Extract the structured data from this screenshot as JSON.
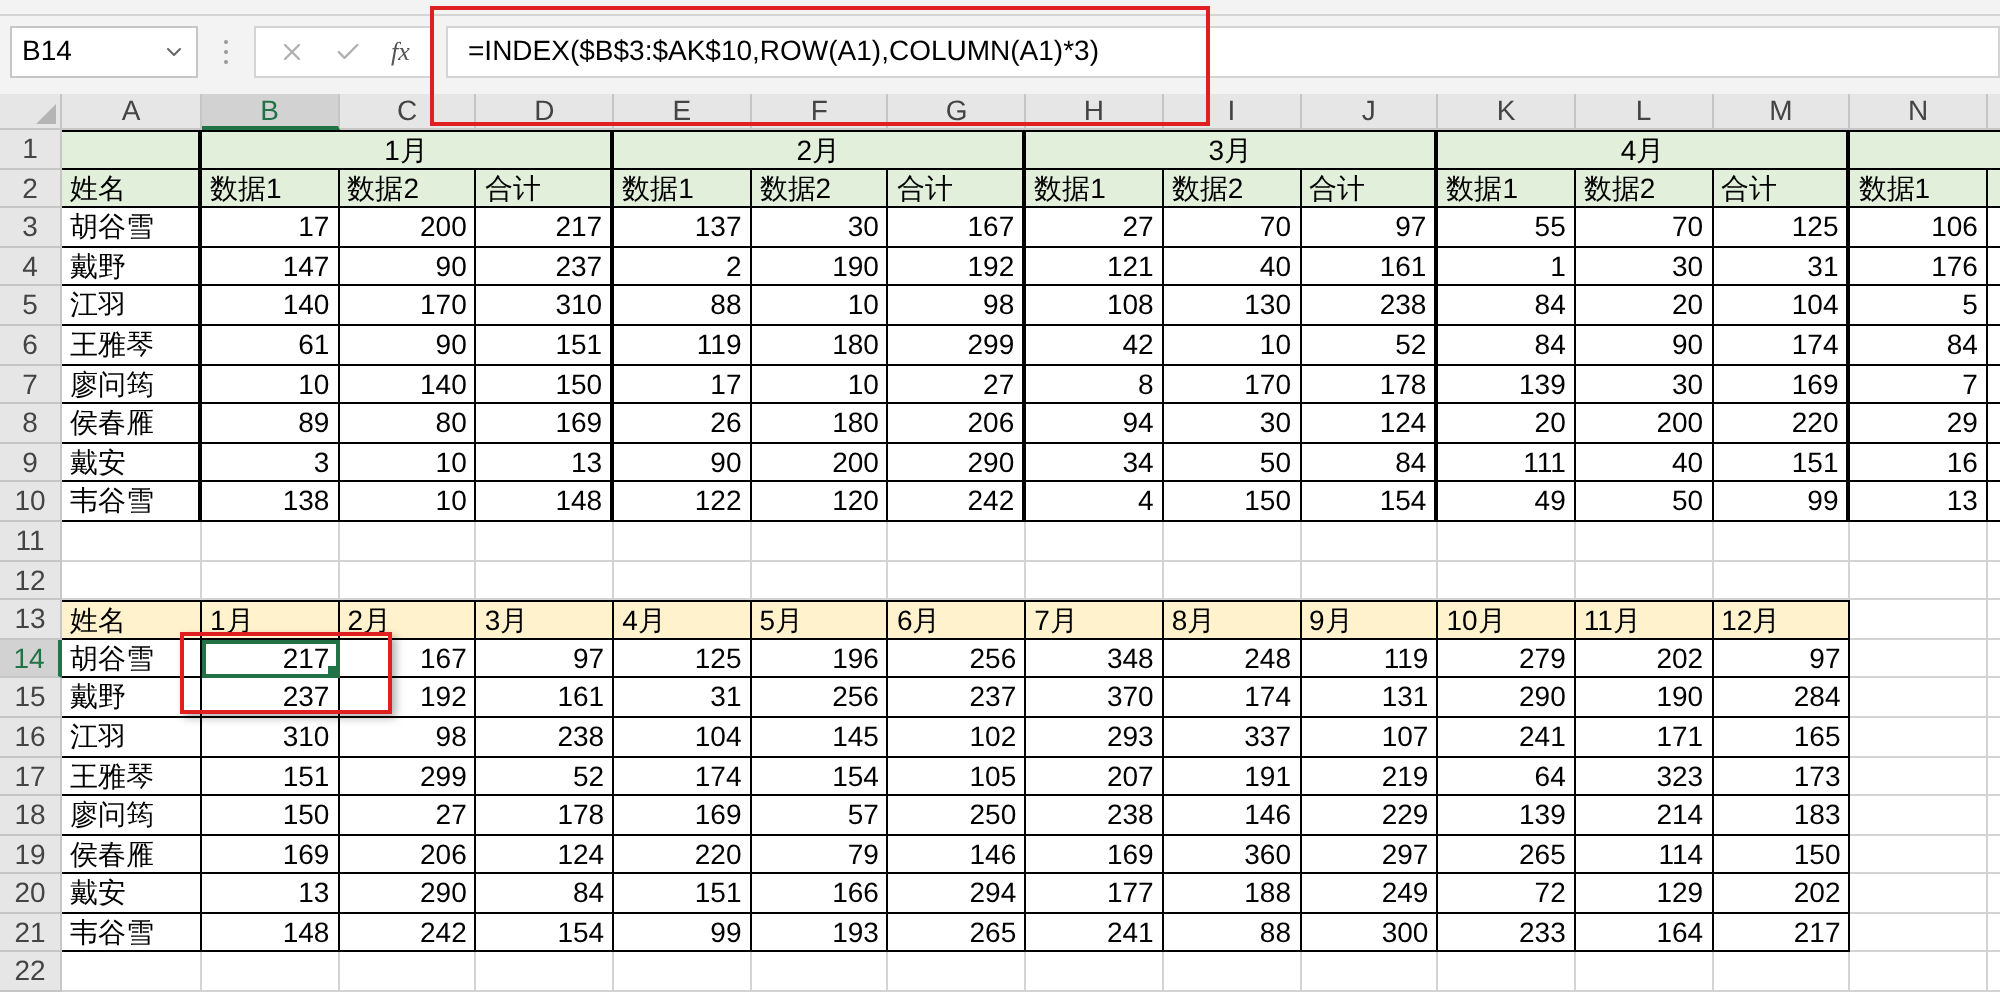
{
  "name_box": "B14",
  "function_label": "fx",
  "formula": "=INDEX($B$3:$AK$10,ROW(A1),COLUMN(A1)*3)",
  "columns": [
    {
      "label": "A",
      "selected": false
    },
    {
      "label": "B",
      "selected": true
    },
    {
      "label": "C",
      "selected": false
    },
    {
      "label": "D",
      "selected": false
    },
    {
      "label": "E",
      "selected": false
    },
    {
      "label": "F",
      "selected": false
    },
    {
      "label": "G",
      "selected": false
    },
    {
      "label": "H",
      "selected": false
    },
    {
      "label": "I",
      "selected": false
    },
    {
      "label": "J",
      "selected": false
    },
    {
      "label": "K",
      "selected": false
    },
    {
      "label": "L",
      "selected": false
    },
    {
      "label": "M",
      "selected": false
    },
    {
      "label": "N",
      "selected": false
    }
  ],
  "rows": [
    {
      "label": "1",
      "selected": false
    },
    {
      "label": "2",
      "selected": false
    },
    {
      "label": "3",
      "selected": false
    },
    {
      "label": "4",
      "selected": false
    },
    {
      "label": "5",
      "selected": false
    },
    {
      "label": "6",
      "selected": false
    },
    {
      "label": "7",
      "selected": false
    },
    {
      "label": "8",
      "selected": false
    },
    {
      "label": "9",
      "selected": false
    },
    {
      "label": "10",
      "selected": false
    },
    {
      "label": "11",
      "selected": false
    },
    {
      "label": "12",
      "selected": false
    },
    {
      "label": "13",
      "selected": false
    },
    {
      "label": "14",
      "selected": true
    },
    {
      "label": "15",
      "selected": false
    },
    {
      "label": "16",
      "selected": false
    },
    {
      "label": "17",
      "selected": false
    },
    {
      "label": "18",
      "selected": false
    },
    {
      "label": "19",
      "selected": false
    },
    {
      "label": "20",
      "selected": false
    },
    {
      "label": "21",
      "selected": false
    },
    {
      "label": "22",
      "selected": false
    }
  ],
  "top_table": {
    "month_groups": [
      "1月",
      "2月",
      "3月",
      "4月"
    ],
    "name_header": "姓名",
    "subheaders": [
      "数据1",
      "数据2",
      "合计",
      "数据1",
      "数据2",
      "合计",
      "数据1",
      "数据2",
      "合计",
      "数据1",
      "数据2",
      "合计",
      "数据1"
    ],
    "rows": [
      {
        "name": "胡谷雪",
        "values": [
          "17",
          "200",
          "217",
          "137",
          "30",
          "167",
          "27",
          "70",
          "97",
          "55",
          "70",
          "125",
          "106"
        ]
      },
      {
        "name": "戴野",
        "values": [
          "147",
          "90",
          "237",
          "2",
          "190",
          "192",
          "121",
          "40",
          "161",
          "1",
          "30",
          "31",
          "176"
        ]
      },
      {
        "name": "江羽",
        "values": [
          "140",
          "170",
          "310",
          "88",
          "10",
          "98",
          "108",
          "130",
          "238",
          "84",
          "20",
          "104",
          "5"
        ]
      },
      {
        "name": "王雅琴",
        "values": [
          "61",
          "90",
          "151",
          "119",
          "180",
          "299",
          "42",
          "10",
          "52",
          "84",
          "90",
          "174",
          "84"
        ]
      },
      {
        "name": "廖问筠",
        "values": [
          "10",
          "140",
          "150",
          "17",
          "10",
          "27",
          "8",
          "170",
          "178",
          "139",
          "30",
          "169",
          "7"
        ]
      },
      {
        "name": "侯春雁",
        "values": [
          "89",
          "80",
          "169",
          "26",
          "180",
          "206",
          "94",
          "30",
          "124",
          "20",
          "200",
          "220",
          "29"
        ]
      },
      {
        "name": "戴安",
        "values": [
          "3",
          "10",
          "13",
          "90",
          "200",
          "290",
          "34",
          "50",
          "84",
          "111",
          "40",
          "151",
          "16"
        ]
      },
      {
        "name": "韦谷雪",
        "values": [
          "138",
          "10",
          "148",
          "122",
          "120",
          "242",
          "4",
          "150",
          "154",
          "49",
          "50",
          "99",
          "13"
        ]
      }
    ]
  },
  "bottom_table": {
    "name_header": "姓名",
    "months": [
      "1月",
      "2月",
      "3月",
      "4月",
      "5月",
      "6月",
      "7月",
      "8月",
      "9月",
      "10月",
      "11月",
      "12月"
    ],
    "rows": [
      {
        "name": "胡谷雪",
        "values": [
          "217",
          "167",
          "97",
          "125",
          "196",
          "256",
          "348",
          "248",
          "119",
          "279",
          "202",
          "97"
        ]
      },
      {
        "name": "戴野",
        "values": [
          "237",
          "192",
          "161",
          "31",
          "256",
          "237",
          "370",
          "174",
          "131",
          "290",
          "190",
          "284"
        ]
      },
      {
        "name": "江羽",
        "values": [
          "310",
          "98",
          "238",
          "104",
          "145",
          "102",
          "293",
          "337",
          "107",
          "241",
          "171",
          "165"
        ]
      },
      {
        "name": "王雅琴",
        "values": [
          "151",
          "299",
          "52",
          "174",
          "154",
          "105",
          "207",
          "191",
          "219",
          "64",
          "323",
          "173"
        ]
      },
      {
        "name": "廖问筠",
        "values": [
          "150",
          "27",
          "178",
          "169",
          "57",
          "250",
          "238",
          "146",
          "229",
          "139",
          "214",
          "183"
        ]
      },
      {
        "name": "侯春雁",
        "values": [
          "169",
          "206",
          "124",
          "220",
          "79",
          "146",
          "169",
          "360",
          "297",
          "265",
          "114",
          "150"
        ]
      },
      {
        "name": "戴安",
        "values": [
          "13",
          "290",
          "84",
          "151",
          "166",
          "294",
          "177",
          "188",
          "249",
          "72",
          "129",
          "202"
        ]
      },
      {
        "name": "韦谷雪",
        "values": [
          "148",
          "242",
          "154",
          "99",
          "193",
          "265",
          "241",
          "88",
          "300",
          "233",
          "164",
          "217"
        ]
      }
    ]
  }
}
